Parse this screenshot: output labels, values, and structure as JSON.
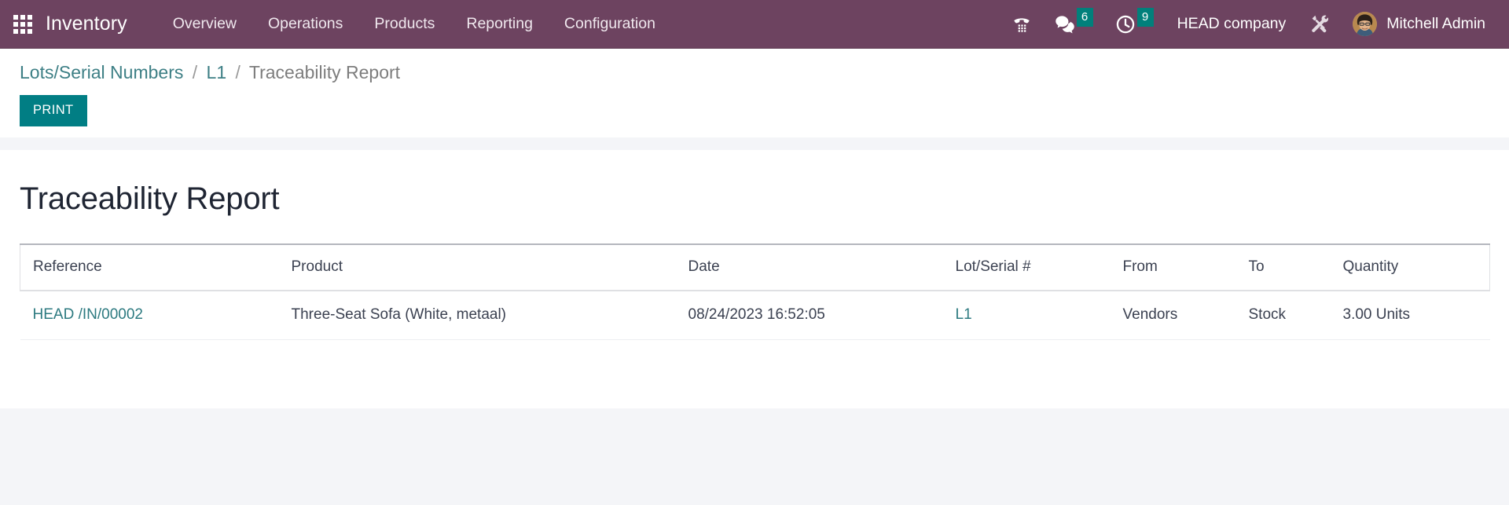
{
  "navbar": {
    "apps_icon": "apps-grid-icon",
    "brand": "Inventory",
    "menu": [
      {
        "label": "Overview"
      },
      {
        "label": "Operations"
      },
      {
        "label": "Products"
      },
      {
        "label": "Reporting"
      },
      {
        "label": "Configuration"
      }
    ],
    "systray": {
      "dialpad_icon": "dialpad-phone-icon",
      "messages_icon": "messages-icon",
      "messages_count": "6",
      "activities_icon": "clock-activities-icon",
      "activities_count": "9",
      "company": "HEAD company",
      "tools_icon": "wrench-screwdriver-icon",
      "avatar_icon": "user-avatar",
      "user": "Mitchell Admin"
    },
    "colors": {
      "navbar_bg": "#6d4360",
      "badge_bg": "#01807b"
    }
  },
  "control_panel": {
    "breadcrumb": {
      "root": "Lots/Serial Numbers",
      "parent": "L1",
      "current": "Traceability Report",
      "separator": "/"
    },
    "print_label": "PRINT",
    "print_color": "#017e84"
  },
  "report": {
    "title": "Traceability Report",
    "columns": [
      "Reference",
      "Product",
      "Date",
      "Lot/Serial #",
      "From",
      "To",
      "Quantity"
    ],
    "rows": [
      {
        "reference": "HEAD /IN/00002",
        "product": "Three-Seat Sofa (White, metaal)",
        "date": "08/24/2023 16:52:05",
        "lot_serial": "L1",
        "from": "Vendors",
        "to": "Stock",
        "quantity": "3.00 Units"
      }
    ]
  }
}
